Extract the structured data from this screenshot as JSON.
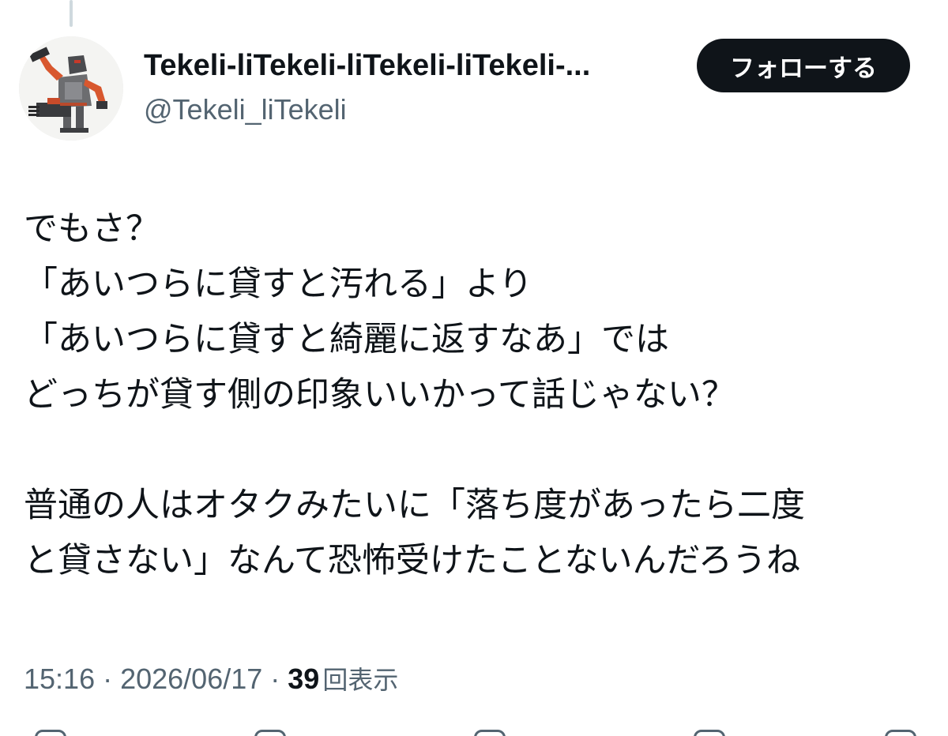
{
  "author": {
    "display_name": "Tekeli-liTekeli-liTekeli-liTekeli-...",
    "handle": "@Tekeli_liTekeli"
  },
  "follow_button": {
    "label": "フォローする"
  },
  "tweet": {
    "lines": [
      "でもさ？",
      "「あいつらに貸すと汚れる」より",
      "「あいつらに貸すと綺麗に返すなあ」では",
      "どっちが貸す側の印象いいかって話じゃない？",
      "",
      "普通の人はオタクみたいに「落ち度があったら二度",
      "と貸さない」なんて恐怖受けたことないんだろうね"
    ]
  },
  "meta": {
    "time": "15:16",
    "date": "2026/06/17",
    "separator": "·",
    "views_count": "39",
    "views_label": "回表示"
  },
  "colors": {
    "text_primary": "#0f1419",
    "text_secondary": "#536471",
    "button_bg": "#0f1419",
    "button_text": "#ffffff",
    "thread_line": "#cfd9de"
  },
  "icons": {
    "avatar": "robot-gunner-avatar",
    "reply": "reply-icon",
    "retweet": "retweet-icon",
    "like": "heart-icon",
    "bookmark": "bookmark-icon",
    "share": "share-icon"
  }
}
